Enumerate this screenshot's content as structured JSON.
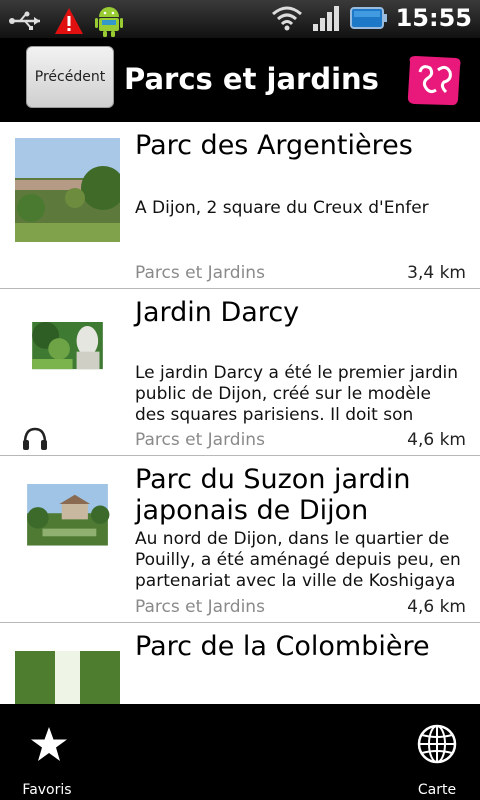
{
  "status_bar": {
    "time": "15:55",
    "icons": [
      "usb-icon",
      "warning-icon",
      "android-icon",
      "wifi-icon",
      "signal-icon",
      "battery-icon"
    ]
  },
  "header": {
    "back_label": "Précédent",
    "title": "Parcs et jardins",
    "logo_icon": "app-logo-icon",
    "accent_color": "#e8197a"
  },
  "items": [
    {
      "title": "Parc des Argentières",
      "description": "A Dijon, 2 square du Creux d'Enfer",
      "category": "Parcs et Jardins",
      "distance": "3,4 km",
      "has_audio": false
    },
    {
      "title": "Jardin Darcy",
      "description": "Le jardin Darcy a été le premier jardin public de Dijon, créé sur le modèle des squares parisiens. Il doit son origine au",
      "category": "Parcs et Jardins",
      "distance": "4,6 km",
      "has_audio": true
    },
    {
      "title": "Parc du Suzon jardin japonais de Dijon",
      "description": "Au nord de Dijon, dans le quartier de Pouilly, a été aménagé depuis peu, en partenariat avec la ville de Koshigaya au",
      "category": "Parcs et Jardins",
      "distance": "4,6 km",
      "has_audio": false
    },
    {
      "title": "Parc de la Colombière",
      "description": "",
      "category": "",
      "distance": "",
      "has_audio": false
    }
  ],
  "bottom_bar": {
    "favorites_label": "Favoris",
    "map_label": "Carte"
  }
}
